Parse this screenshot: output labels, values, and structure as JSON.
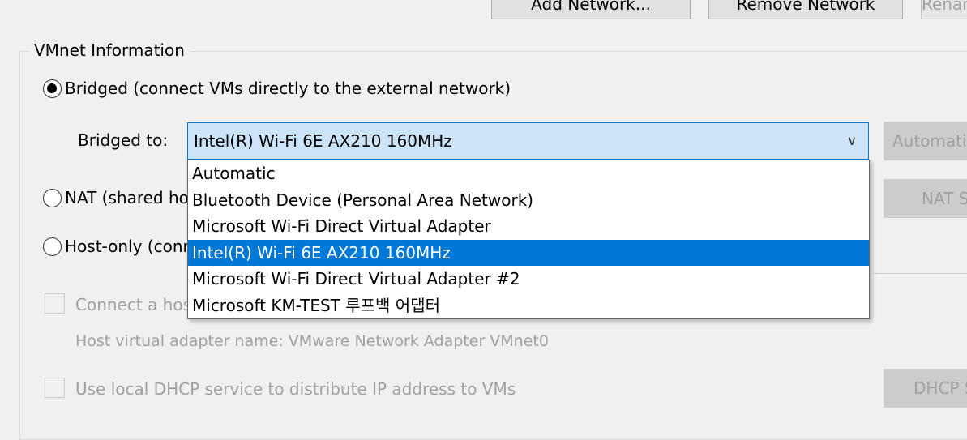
{
  "top_buttons": {
    "add_network": "Add Network...",
    "remove_network": "Remove Network",
    "rename_network": "Rename Network..."
  },
  "vmnet_info": {
    "title": "VMnet Information",
    "bridged_label": "Bridged (connect VMs directly to the external network)",
    "bridged_to_label": "Bridged to:",
    "bridged_to_value": "Intel(R) Wi-Fi 6E AX210 160MHz",
    "automatic_settings_button": "Automatic Settings...",
    "nat_label": "NAT (shared host's IP address with VMs)",
    "nat_settings_button": "NAT Settings...",
    "host_only_label": "Host-only (connect VMs internally in a private network)",
    "connect_host_adapter_label": "Connect a host virtual adapter to this network",
    "host_adapter_name": "Host virtual adapter name: VMware Network Adapter VMnet0",
    "dhcp_label": "Use local DHCP service to distribute IP address to VMs",
    "dhcp_settings_button": "DHCP Settings..."
  },
  "dropdown": {
    "options": [
      "Automatic",
      "Bluetooth Device (Personal Area Network)",
      "Microsoft Wi-Fi Direct Virtual Adapter",
      "Intel(R) Wi-Fi 6E AX210 160MHz",
      "Microsoft Wi-Fi Direct Virtual Adapter #2",
      "Microsoft KM-TEST 루프백 어댑터"
    ],
    "selected_index": 3
  },
  "colors": {
    "selection": "#0078d7",
    "combo_background": "#cce4f7",
    "disabled_text": "#a0a0a0"
  }
}
